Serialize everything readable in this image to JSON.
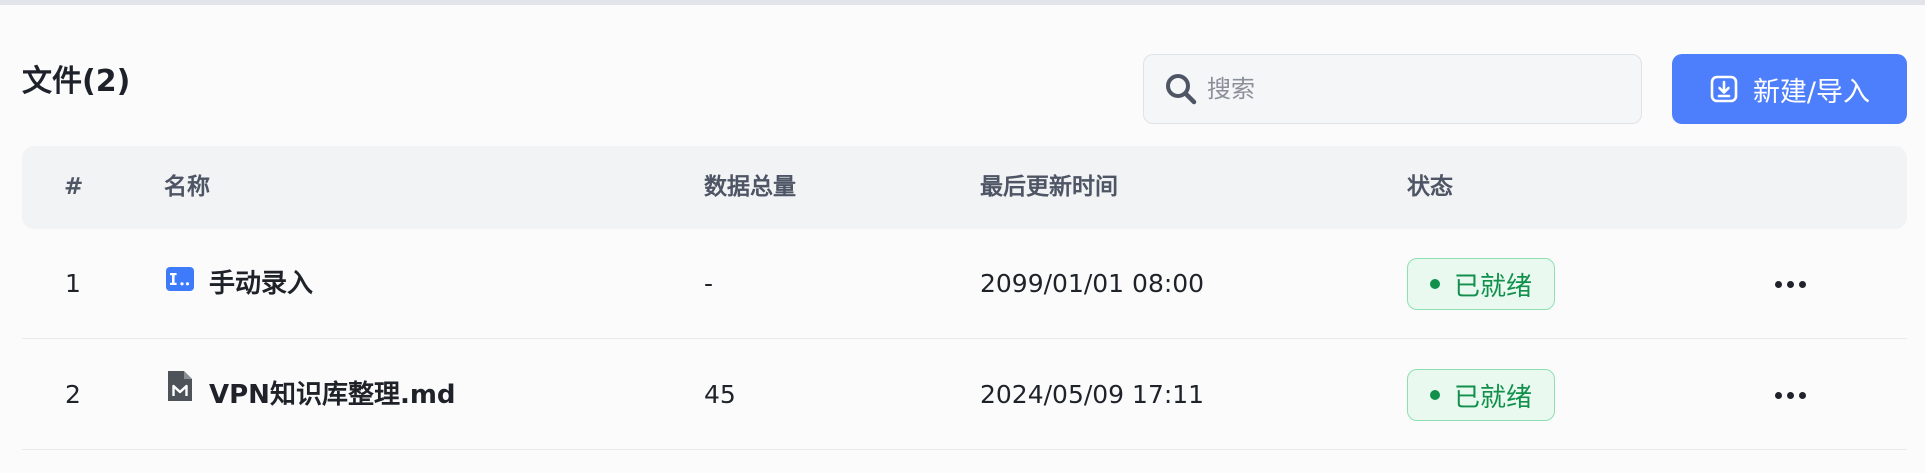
{
  "header": {
    "title": "文件(2)",
    "search_placeholder": "搜索",
    "new_button_label": "新建/导入"
  },
  "table": {
    "columns": [
      "#",
      "名称",
      "数据总量",
      "最后更新时间",
      "状态"
    ],
    "rows": [
      {
        "index": "1",
        "name": "手动录入",
        "icon": "manual-input-icon",
        "total": "-",
        "updated": "2099/01/01 08:00",
        "status": "已就绪"
      },
      {
        "index": "2",
        "name": "VPN知识库整理.md",
        "icon": "markdown-file-icon",
        "total": "45",
        "updated": "2024/05/09 17:11",
        "status": "已就绪"
      }
    ]
  },
  "colors": {
    "accent": "#4d7efb",
    "status_green": "#11904c",
    "status_bg": "#e9f9ef"
  }
}
